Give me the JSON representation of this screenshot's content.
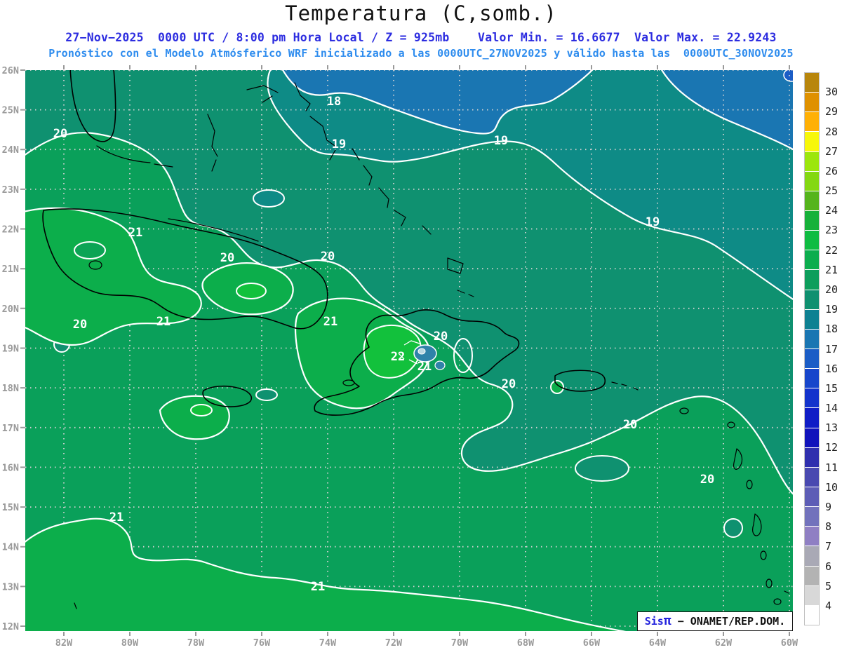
{
  "header": {
    "title": "Temperatura (C,somb.)",
    "line1": "27−Nov−2025  0000 UTC / 8:00 pm Hora Local / Z = 925mb    Valor Min. = 16.6677  Valor Max. = 22.9243",
    "line2": "Pronóstico con el Modelo Atmósferico WRF inicializado a las 0000UTC_27NOV2025 y válido hasta las  0000UTC_30NOV2025"
  },
  "values": {
    "min": "16.6677",
    "max": "22.9243",
    "level": "925mb",
    "valid_from": "0000UTC_27NOV2025",
    "valid_to": "0000UTC_30NOV2025",
    "variable": "Temperatura (C)"
  },
  "axes": {
    "lat": [
      "26N",
      "25N",
      "24N",
      "23N",
      "22N",
      "21N",
      "20N",
      "19N",
      "18N",
      "17N",
      "16N",
      "15N",
      "14N",
      "13N",
      "12N"
    ],
    "lon": [
      "82W",
      "80W",
      "78W",
      "76W",
      "74W",
      "72W",
      "70W",
      "68W",
      "66W",
      "64W",
      "62W",
      "60W"
    ]
  },
  "colorbar": {
    "labels": [
      "30",
      "29",
      "28",
      "27",
      "26",
      "25",
      "24",
      "23",
      "22",
      "21",
      "20",
      "19",
      "18",
      "17",
      "16",
      "15",
      "14",
      "13",
      "12",
      "11",
      "10",
      "9",
      "8",
      "7",
      "6",
      "5",
      "4"
    ],
    "cells": [
      "#b8860c",
      "#df9100",
      "#ffb005",
      "#f7f70a",
      "#9ce60c",
      "#84d812",
      "#55b41c",
      "#16b13a",
      "#0fbc42",
      "#0cad4e",
      "#0d9e5c",
      "#0f9070",
      "#0e8192",
      "#1a76b2",
      "#1b5dc6",
      "#1746cb",
      "#1333cc",
      "#101dc6",
      "#1113bb",
      "#2f2fae",
      "#4949b0",
      "#5d5db6",
      "#7272bc",
      "#8f7fc3",
      "#a9a9b5",
      "#b3b3b3",
      "#d8d8d8",
      "#ffffff"
    ]
  },
  "map": {
    "region_colors": {
      "c17": "#1a76b2",
      "c18": "#0e8b86",
      "c19": "#0f9170",
      "c20": "#0aa05a",
      "c21": "#0cae4b",
      "c22": "#12c13c",
      "mountain_cool": "#2f82a9",
      "mountain_core": "#bcd8e2",
      "corner_spot": "#1b5dc6",
      "westcuba_inner": "#0ca455"
    },
    "contour_labels": [
      {
        "text": "20"
      },
      {
        "text": "18"
      },
      {
        "text": "19"
      },
      {
        "text": "19"
      },
      {
        "text": "19"
      },
      {
        "text": "21"
      },
      {
        "text": "20"
      },
      {
        "text": "20"
      },
      {
        "text": "20"
      },
      {
        "text": "21"
      },
      {
        "text": "21"
      },
      {
        "text": "20"
      },
      {
        "text": "22"
      },
      {
        "text": "21"
      },
      {
        "text": "20"
      },
      {
        "text": "20"
      },
      {
        "text": "20"
      },
      {
        "text": "21"
      },
      {
        "text": "21"
      }
    ],
    "contour_interval": "1 C"
  },
  "footer": {
    "brand": "Sis",
    "pi": "π",
    "org": " − ONAMET/REP.DOM."
  }
}
